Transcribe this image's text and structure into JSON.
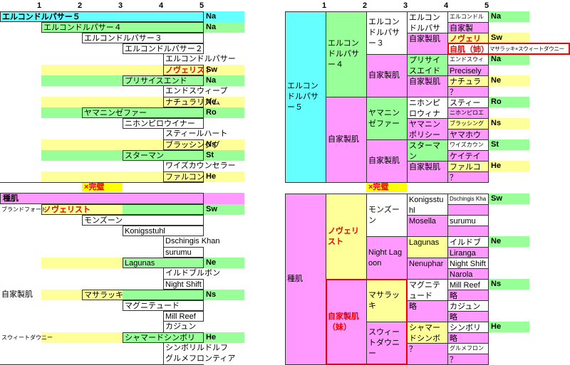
{
  "colors": {
    "cyan": "#66ffff",
    "green": "#99ff99",
    "yellow": "#ffff99",
    "magenta": "#ff99ff",
    "white": "#ffffff",
    "red": "#ee0000"
  },
  "generation_headers": [
    "1",
    "2",
    "3",
    "4",
    "5"
  ],
  "perfect_mark": "×完璧",
  "left_top": {
    "rows": [
      {
        "name": "エルコンドルパサー５",
        "badge": "Na",
        "highlight": "cyan"
      },
      {
        "name": "エルコンドルパサー４",
        "badge": "Na",
        "highlight": "green"
      },
      {
        "name": "エルコンドルパサー３",
        "badge": "",
        "highlight": ""
      },
      {
        "name": "エルコンドルパサー２",
        "badge": "",
        "highlight": ""
      },
      {
        "name": "エルコンドルパサー",
        "badge": "",
        "highlight": ""
      },
      {
        "name": "ノヴェリスト",
        "badge": "Sw",
        "highlight": "yellow",
        "emphasis": true
      },
      {
        "name": "プリサイスエンド",
        "badge": "Na",
        "highlight": "green"
      },
      {
        "name": "エンドスウィープ",
        "badge": "",
        "highlight": ""
      },
      {
        "name": "ナチュラリズム",
        "badge": "Ne",
        "highlight": "yellow"
      },
      {
        "name": "ヤマニンゼファー",
        "badge": "Ro",
        "highlight": "green"
      },
      {
        "name": "ニホンピロウイナー",
        "badge": "",
        "highlight": ""
      },
      {
        "name": "スティールハート",
        "badge": "",
        "highlight": ""
      },
      {
        "name": "ブラッシンググ",
        "badge": "Ns",
        "highlight": "yellow"
      },
      {
        "name": "スターマン",
        "badge": "St",
        "highlight": "green"
      },
      {
        "name": "ワイズカウンセラー",
        "badge": "",
        "highlight": ""
      },
      {
        "name": "ファルコン",
        "badge": "He",
        "highlight": "yellow"
      }
    ]
  },
  "left_bottom": {
    "title": "種肌",
    "side_labels": [
      "ブランドフォード",
      "自家製肌",
      "スウィートダウニー"
    ],
    "rows": [
      {
        "name": "ノヴェリスト",
        "badge": "Sw",
        "emphasis": true
      },
      {
        "name": "モンズーン",
        "badge": ""
      },
      {
        "name": "Konigsstuhl",
        "badge": ""
      },
      {
        "name": "Dschingis Khan",
        "badge": ""
      },
      {
        "name": "surumu",
        "badge": ""
      },
      {
        "name": "Lagunas",
        "badge": "Ne"
      },
      {
        "name": "イルドブルボン",
        "badge": ""
      },
      {
        "name": "Night Shift",
        "badge": ""
      },
      {
        "name": "マサラッキ",
        "badge": "Ns"
      },
      {
        "name": "マグニテュード",
        "badge": ""
      },
      {
        "name": "Mill Reef",
        "badge": ""
      },
      {
        "name": "カジュン",
        "badge": ""
      },
      {
        "name": "シャマードシンボリ",
        "badge": "He"
      },
      {
        "name": "シンボリルドルフ",
        "badge": ""
      },
      {
        "name": "グルメフロンティア",
        "badge": ""
      }
    ]
  },
  "right_top": {
    "cells": [
      {
        "name": "エルコンドルパサー５",
        "fill": "cyan"
      },
      {
        "name": "エルコンドルパサー４",
        "fill": "green"
      },
      {
        "name": "自家製肌",
        "fill": "magenta"
      },
      {
        "name": "エルコンドルパサー３",
        "fill": "white"
      },
      {
        "name": "自家製肌",
        "fill": "magenta"
      },
      {
        "name": "ヤマニンゼファー",
        "fill": "green"
      },
      {
        "name": "自家製肌",
        "fill": "magenta"
      },
      {
        "name": "エルコンドルパサー２",
        "fill": "white"
      },
      {
        "name": "自家製肌",
        "fill": "magenta"
      },
      {
        "name": "プリサイスエイド",
        "fill": "green"
      },
      {
        "name": "自家製肌",
        "fill": "magenta"
      },
      {
        "name": "ニホンピロウィナー",
        "fill": "white"
      },
      {
        "name": "ヤマニンポリシー",
        "fill": "magenta"
      },
      {
        "name": "スターマン",
        "fill": "green"
      },
      {
        "name": "自家製肌",
        "fill": "magenta"
      },
      {
        "name": "エルコンドルパサー",
        "fill": "white"
      },
      {
        "name": "自家製",
        "fill": "magenta"
      },
      {
        "name": "ノヴェリスト",
        "fill": "yellow",
        "emphasis": true
      },
      {
        "name": "自肌（姉）",
        "fill": "white",
        "emphasis": true
      },
      {
        "name": "エンドスウィープ",
        "fill": "white"
      },
      {
        "name": "Precisely",
        "fill": "magenta"
      },
      {
        "name": "ナチュラリズム",
        "fill": "yellow"
      },
      {
        "name": "？",
        "fill": "magenta"
      },
      {
        "name": "スティールハート",
        "fill": "white"
      },
      {
        "name": "ニホンピロエバート",
        "fill": "magenta"
      },
      {
        "name": "ブラッシンググルーム",
        "fill": "yellow"
      },
      {
        "name": "ヤマホウユウ",
        "fill": "magenta"
      },
      {
        "name": "ワイズカウンセラー",
        "fill": "white"
      },
      {
        "name": "ケイテイルート",
        "fill": "magenta"
      },
      {
        "name": "ファルコン",
        "fill": "yellow"
      },
      {
        "name": "？",
        "fill": "magenta"
      }
    ],
    "badges": [
      {
        "text": "Na",
        "fill": "green"
      },
      {
        "text": "",
        "fill": ""
      },
      {
        "text": "Sw",
        "fill": "yellow"
      },
      {
        "text": "マサラッキ×スウィートダウニー",
        "fill": "white",
        "note": true
      },
      {
        "text": "Na",
        "fill": "green"
      },
      {
        "text": "",
        "fill": ""
      },
      {
        "text": "Ne",
        "fill": "yellow"
      },
      {
        "text": "",
        "fill": ""
      },
      {
        "text": "Ro",
        "fill": "green"
      },
      {
        "text": "",
        "fill": ""
      },
      {
        "text": "Ns",
        "fill": "yellow"
      },
      {
        "text": "",
        "fill": ""
      },
      {
        "text": "St",
        "fill": "green"
      },
      {
        "text": "",
        "fill": ""
      },
      {
        "text": "He",
        "fill": "yellow"
      },
      {
        "text": "",
        "fill": ""
      }
    ]
  },
  "right_bottom": {
    "cells": [
      {
        "name": "種肌",
        "fill": "magenta"
      },
      {
        "name": "ノヴェリスト",
        "fill": "yellow",
        "emphasis": true
      },
      {
        "name": "自家製肌\n（妹）",
        "fill": "magenta",
        "emphasis": true
      },
      {
        "name": "モンズーン",
        "fill": "white"
      },
      {
        "name": "Night Lagoon",
        "fill": "magenta"
      },
      {
        "name": "マサラッキ",
        "fill": "yellow"
      },
      {
        "name": "スウィートダウニー",
        "fill": "magenta"
      },
      {
        "name": "Konigsstuhl",
        "fill": "white"
      },
      {
        "name": "Mosella",
        "fill": "magenta"
      },
      {
        "name": "Lagunas",
        "fill": "yellow"
      },
      {
        "name": "Nenuphar",
        "fill": "magenta"
      },
      {
        "name": "マグニテュード",
        "fill": "white"
      },
      {
        "name": "略",
        "fill": "magenta"
      },
      {
        "name": "シャマードシンボリ",
        "fill": "yellow"
      },
      {
        "name": "？",
        "fill": "magenta"
      },
      {
        "name": "Dschingis Khan",
        "fill": "white"
      },
      {
        "name": "",
        "fill": "magenta"
      },
      {
        "name": "surumu",
        "fill": "white"
      },
      {
        "name": "",
        "fill": "magenta"
      },
      {
        "name": "イルドブルボン",
        "fill": "white"
      },
      {
        "name": "Liranga",
        "fill": "magenta"
      },
      {
        "name": "Night Shift",
        "fill": "white"
      },
      {
        "name": "Narola",
        "fill": "magenta"
      },
      {
        "name": "Mill Reef",
        "fill": "white"
      },
      {
        "name": "略",
        "fill": "magenta"
      },
      {
        "name": "カジュン",
        "fill": "white"
      },
      {
        "name": "略",
        "fill": "magenta"
      },
      {
        "name": "シンボリルドルフ",
        "fill": "white"
      },
      {
        "name": "略",
        "fill": "magenta"
      },
      {
        "name": "グルメフロンティア",
        "fill": "white"
      },
      {
        "name": "？",
        "fill": "magenta"
      }
    ],
    "badges": [
      {
        "text": "Sw",
        "fill": "green"
      },
      {
        "text": "Ne",
        "fill": "green"
      },
      {
        "text": "Ns",
        "fill": "green"
      },
      {
        "text": "He",
        "fill": "green"
      }
    ]
  }
}
